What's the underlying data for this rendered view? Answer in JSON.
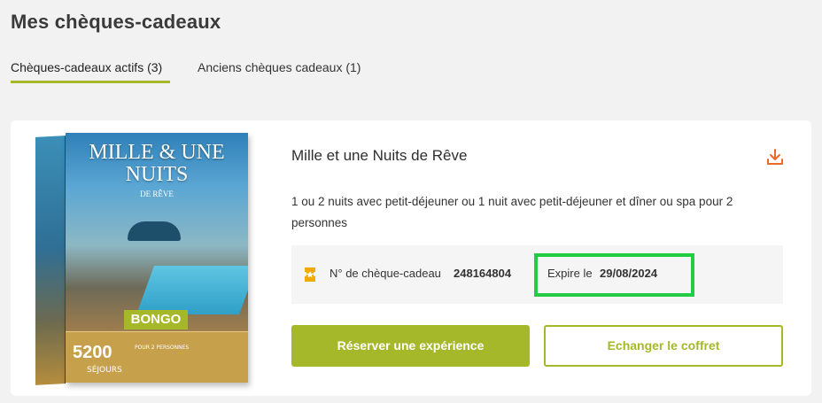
{
  "page": {
    "title": "Mes chèques-cadeaux"
  },
  "tabs": [
    {
      "label": "Chèques-cadeaux actifs (3)",
      "active": true
    },
    {
      "label": "Anciens chèques cadeaux (1)",
      "active": false
    }
  ],
  "card": {
    "box": {
      "title_line1": "MILLE & UNE",
      "title_line2": "NUITS",
      "subtitle": "DE RÊVE",
      "logo": "BONGO",
      "count": "5200",
      "count_label": "SÉJOURS",
      "tag": "POUR 2 PERSONNES"
    },
    "offer_title": "Mille et une Nuits de Rêve",
    "description": "1 ou 2 nuits avec petit-déjeuner ou 1 nuit avec petit-déjeuner et dîner ou spa pour 2 personnes",
    "cheque_label": "N° de chèque-cadeau",
    "cheque_number": "248164804",
    "expiry_label": "Expire le",
    "expiry_date": "29/08/2024",
    "primary_button": "Réserver une expérience",
    "secondary_button": "Echanger le coffret",
    "icons": {
      "download": "download-icon",
      "ticket": "ticket-icon"
    },
    "colors": {
      "accent": "#a5b82a",
      "download_icon": "#e8692a",
      "ticket_icon": "#f2a900",
      "highlight_border": "#22cc44"
    }
  }
}
